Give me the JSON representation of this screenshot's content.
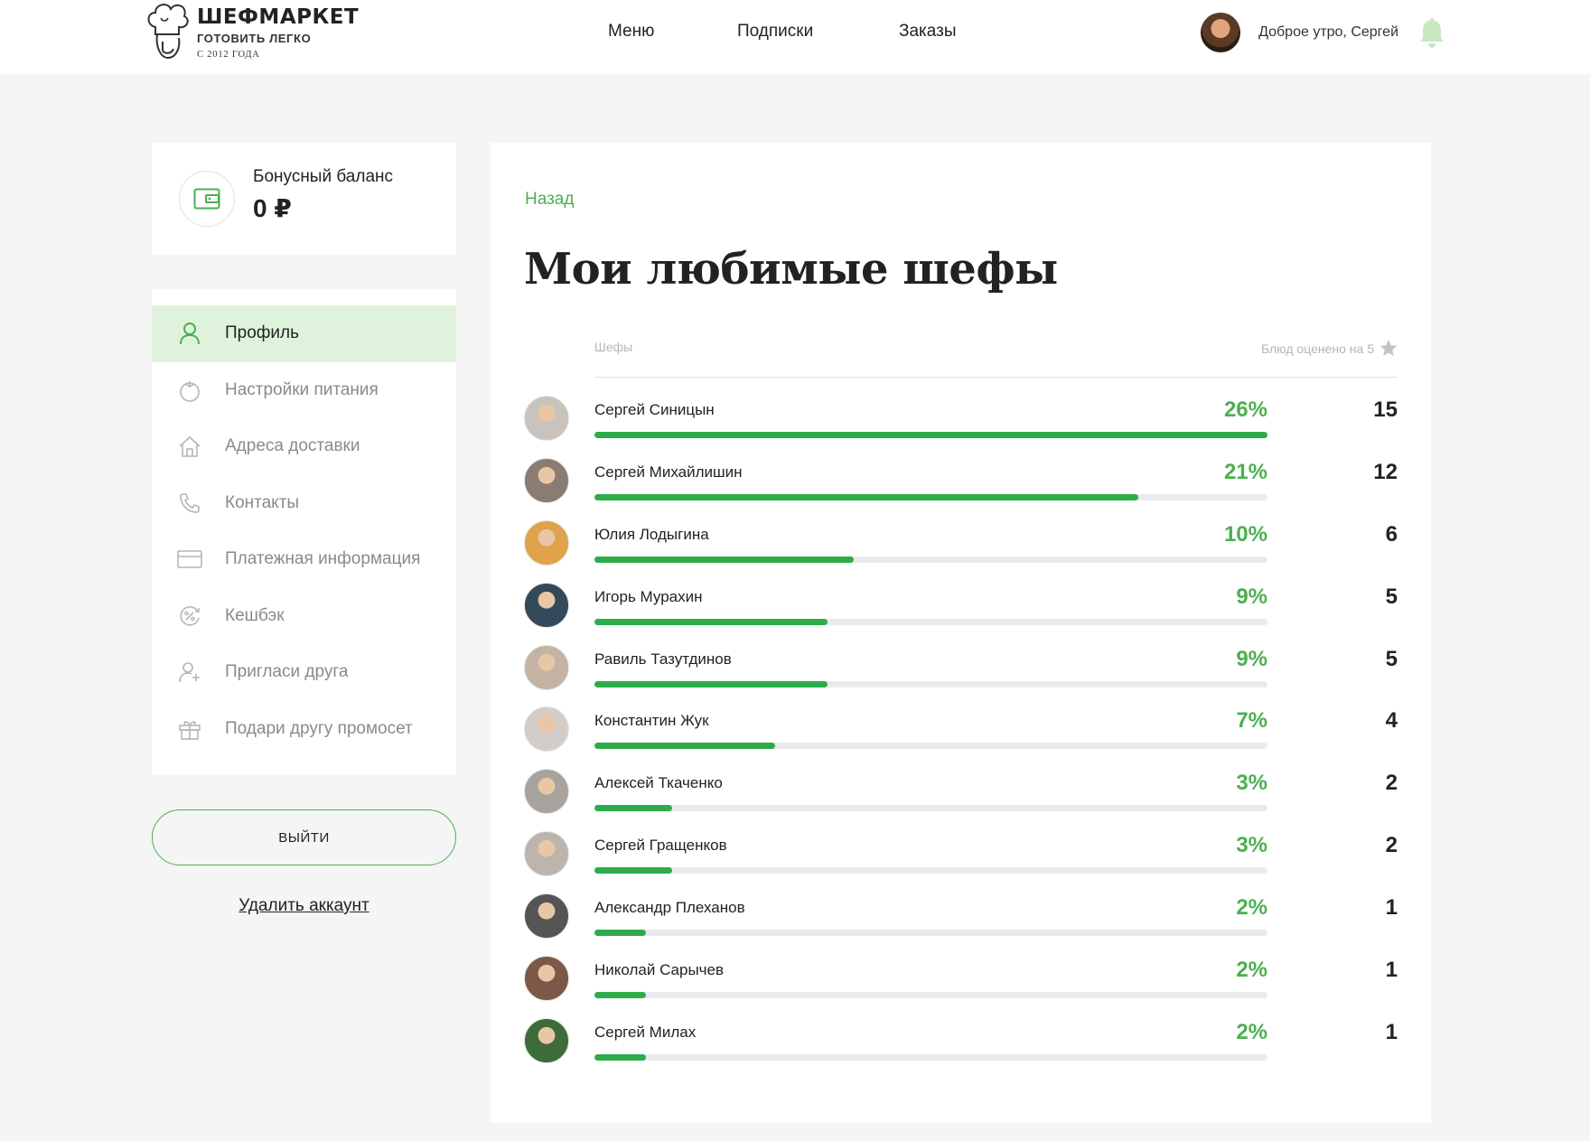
{
  "header": {
    "logo": {
      "name": "ШЕФМАРКЕТ",
      "slogan": "ГОТОВИТЬ ЛЕГКО",
      "since": "С 2012 ГОДА"
    },
    "nav": [
      "Меню",
      "Подписки",
      "Заказы"
    ],
    "greeting": "Доброе утро, Сергей",
    "bell_icon": "bell-icon"
  },
  "sidebar": {
    "balance": {
      "label": "Бонусный баланс",
      "value": "0 ₽"
    },
    "menu": [
      {
        "label": "Профиль",
        "icon": "user-icon",
        "active": true
      },
      {
        "label": "Настройки питания",
        "icon": "tomato-icon",
        "active": false
      },
      {
        "label": "Адреса доставки",
        "icon": "house-icon",
        "active": false
      },
      {
        "label": "Контакты",
        "icon": "phone-icon",
        "active": false
      },
      {
        "label": "Платежная информация",
        "icon": "card-icon",
        "active": false
      },
      {
        "label": "Кешбэк",
        "icon": "cashback-icon",
        "active": false
      },
      {
        "label": "Пригласи друга",
        "icon": "invite-friend-icon",
        "active": false
      },
      {
        "label": "Подари другу промосет",
        "icon": "gift-icon",
        "active": false
      }
    ],
    "logout_label": "ВЫЙТИ",
    "delete_label": "Удалить аккаунт"
  },
  "main": {
    "back_label": "Назад",
    "title": "Мои любимые шефы",
    "col_chefs": "Шефы",
    "col_rated": "Блюд оценено на 5",
    "accent_color": "#2eac4a",
    "chefs": [
      {
        "name": "Сергей Синицын",
        "percent": "26%",
        "count": "15",
        "share": 1.0,
        "avatar": "#c9c3bd"
      },
      {
        "name": "Сергей Михайлишин",
        "percent": "21%",
        "count": "12",
        "share": 0.808,
        "avatar": "#8a7c70"
      },
      {
        "name": "Юлия Лодыгина",
        "percent": "10%",
        "count": "6",
        "share": 0.385,
        "avatar": "#e0a24a"
      },
      {
        "name": "Игорь Мурахин",
        "percent": "9%",
        "count": "5",
        "share": 0.346,
        "avatar": "#34495a"
      },
      {
        "name": "Равиль Тазутдинов",
        "percent": "9%",
        "count": "5",
        "share": 0.346,
        "avatar": "#c4b3a3"
      },
      {
        "name": "Константин Жук",
        "percent": "7%",
        "count": "4",
        "share": 0.269,
        "avatar": "#d4cdc7"
      },
      {
        "name": "Алексей Ткаченко",
        "percent": "3%",
        "count": "2",
        "share": 0.115,
        "avatar": "#a8a39e"
      },
      {
        "name": "Сергей Гращенков",
        "percent": "3%",
        "count": "2",
        "share": 0.115,
        "avatar": "#bdb5ad"
      },
      {
        "name": "Александр Плеханов",
        "percent": "2%",
        "count": "1",
        "share": 0.077,
        "avatar": "#555555"
      },
      {
        "name": "Николай Сарычев",
        "percent": "2%",
        "count": "1",
        "share": 0.077,
        "avatar": "#7d5848"
      },
      {
        "name": "Сергей Милах",
        "percent": "2%",
        "count": "1",
        "share": 0.077,
        "avatar": "#3d6b3a"
      }
    ]
  }
}
